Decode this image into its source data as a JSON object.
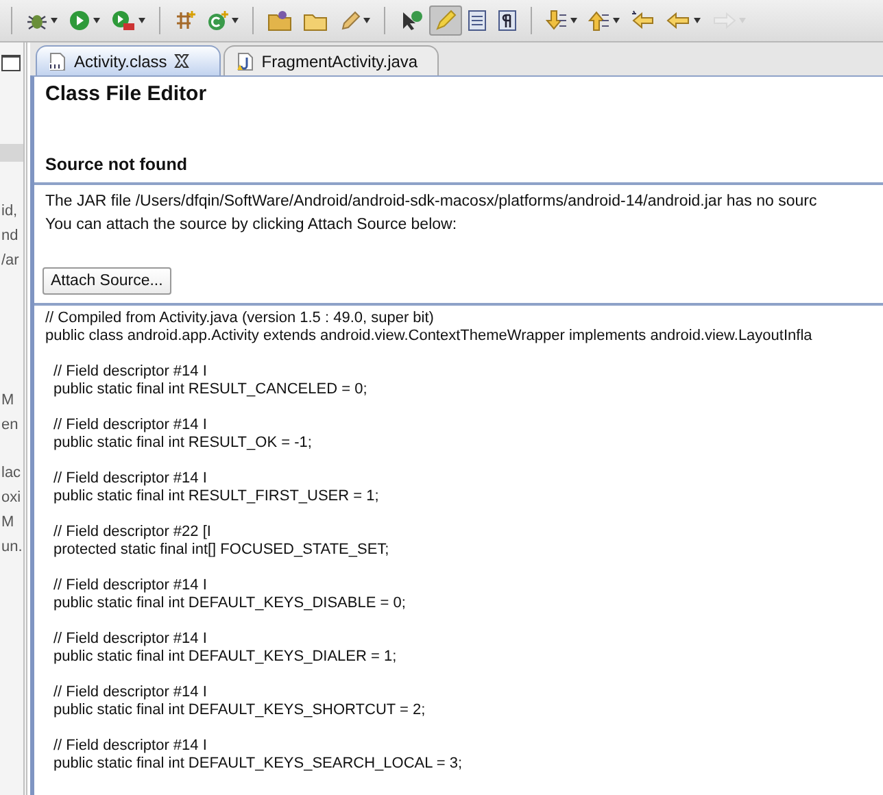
{
  "toolbar": {
    "groups": [
      [
        {
          "pressed": false,
          "dropdown": true,
          "disabled": false
        },
        {
          "pressed": false,
          "dropdown": true,
          "disabled": false
        },
        {
          "pressed": false,
          "dropdown": true,
          "disabled": false
        }
      ],
      [
        {
          "pressed": false,
          "dropdown": false,
          "disabled": false
        },
        {
          "pressed": false,
          "dropdown": true,
          "disabled": false
        }
      ],
      [
        {
          "pressed": false,
          "dropdown": false,
          "disabled": false
        },
        {
          "pressed": false,
          "dropdown": false,
          "disabled": false
        },
        {
          "pressed": false,
          "dropdown": true,
          "disabled": false
        }
      ],
      [
        {
          "pressed": false,
          "dropdown": false,
          "disabled": false
        },
        {
          "pressed": true,
          "dropdown": false,
          "disabled": false
        },
        {
          "pressed": false,
          "dropdown": false,
          "disabled": false
        },
        {
          "pressed": false,
          "dropdown": false,
          "disabled": false
        }
      ],
      [
        {
          "pressed": false,
          "dropdown": true,
          "disabled": false
        },
        {
          "pressed": false,
          "dropdown": true,
          "disabled": false
        },
        {
          "pressed": false,
          "dropdown": false,
          "disabled": false
        },
        {
          "pressed": false,
          "dropdown": true,
          "disabled": false
        },
        {
          "pressed": false,
          "dropdown": true,
          "disabled": true
        }
      ]
    ]
  },
  "left_panel": {
    "fragments": [
      "id,",
      "nd",
      "/ar",
      "M",
      "en",
      "lac",
      "oxi",
      "M",
      "un."
    ]
  },
  "tabs": [
    {
      "label": "Activity.class",
      "selected": true,
      "closable": true,
      "kind": "class"
    },
    {
      "label": "FragmentActivity.java",
      "selected": false,
      "closable": false,
      "kind": "java"
    }
  ],
  "editor": {
    "title": "Class File Editor",
    "section_title": "Source not found",
    "messages": [
      "The JAR file /Users/dfqin/SoftWare/Android/android-sdk-macosx/platforms/android-14/android.jar has no sourc",
      "You can attach the source by clicking Attach Source below:"
    ],
    "button": "Attach Source...",
    "code_blocks": [
      {
        "kind": "header",
        "lines": [
          "// Compiled from Activity.java (version 1.5 : 49.0, super bit)",
          "public class android.app.Activity extends android.view.ContextThemeWrapper implements android.view.LayoutInfla"
        ]
      },
      {
        "kind": "member",
        "lines": [
          "// Field descriptor #14 I",
          "public static final int RESULT_CANCELED = 0;"
        ]
      },
      {
        "kind": "member",
        "lines": [
          "// Field descriptor #14 I",
          "public static final int RESULT_OK = -1;"
        ]
      },
      {
        "kind": "member",
        "lines": [
          "// Field descriptor #14 I",
          "public static final int RESULT_FIRST_USER = 1;"
        ]
      },
      {
        "kind": "member",
        "lines": [
          "// Field descriptor #22 [I",
          "protected static final int[] FOCUSED_STATE_SET;"
        ]
      },
      {
        "kind": "member",
        "lines": [
          "// Field descriptor #14 I",
          "public static final int DEFAULT_KEYS_DISABLE = 0;"
        ]
      },
      {
        "kind": "member",
        "lines": [
          "// Field descriptor #14 I",
          "public static final int DEFAULT_KEYS_DIALER = 1;"
        ]
      },
      {
        "kind": "member",
        "lines": [
          "// Field descriptor #14 I",
          "public static final int DEFAULT_KEYS_SHORTCUT = 2;"
        ]
      },
      {
        "kind": "member",
        "lines": [
          "// Field descriptor #14 I",
          "public static final int DEFAULT_KEYS_SEARCH_LOCAL = 3;"
        ]
      }
    ]
  }
}
